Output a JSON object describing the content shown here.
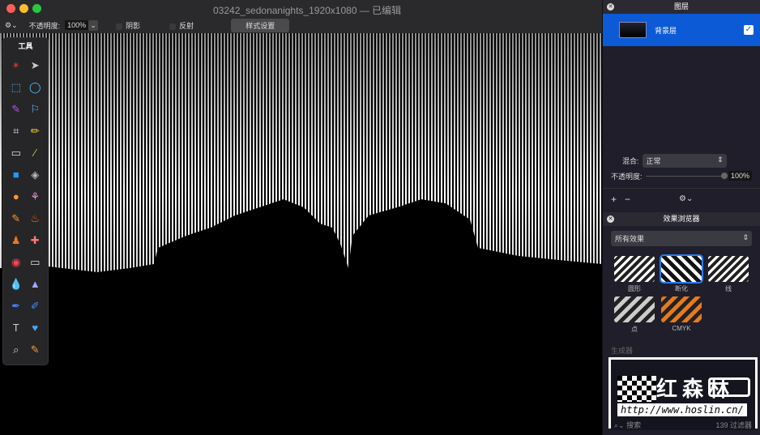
{
  "window": {
    "title": "03242_sedonanights_1920x1080 — 已编辑"
  },
  "toolbar": {
    "gear": "⚙⌄",
    "opacity_label": "不透明度:",
    "opacity_value": "100%",
    "shadow_label": "阴影",
    "reflect_label": "反射",
    "style_button": "样式设置"
  },
  "tools": {
    "title": "工具",
    "icons": [
      "✴",
      "➤",
      "⬚",
      "◯",
      "✎",
      "⚐",
      "⌗",
      "✏",
      "▭",
      "⁄",
      "■",
      "◈",
      "●",
      "⚘",
      "✎",
      "♨",
      "♟",
      "✚",
      "◉",
      "▭",
      "💧",
      "▲",
      "✒",
      "✐",
      "T",
      "♥",
      "⌕",
      "✎"
    ]
  },
  "layers": {
    "title": "图层",
    "layer_name": "背景层",
    "blend_label": "混合:",
    "blend_value": "正常",
    "opacity_label": "不透明度:",
    "opacity_value": "100%",
    "opacity_fraction": 1.0,
    "add": "+",
    "remove": "−",
    "gear": "⚙⌄"
  },
  "effects": {
    "title": "效果浏览器",
    "filter": "所有效果",
    "items": [
      {
        "label": "圆形"
      },
      {
        "label": "断化"
      },
      {
        "label": "线"
      },
      {
        "label": "点"
      },
      {
        "label": "CMYK"
      }
    ],
    "generator_label": "生成器",
    "search_placeholder": "搜索",
    "count": "139 过滤器"
  },
  "watermark": {
    "text": "红森林",
    "url": "http://www.hoslin.cn/"
  }
}
